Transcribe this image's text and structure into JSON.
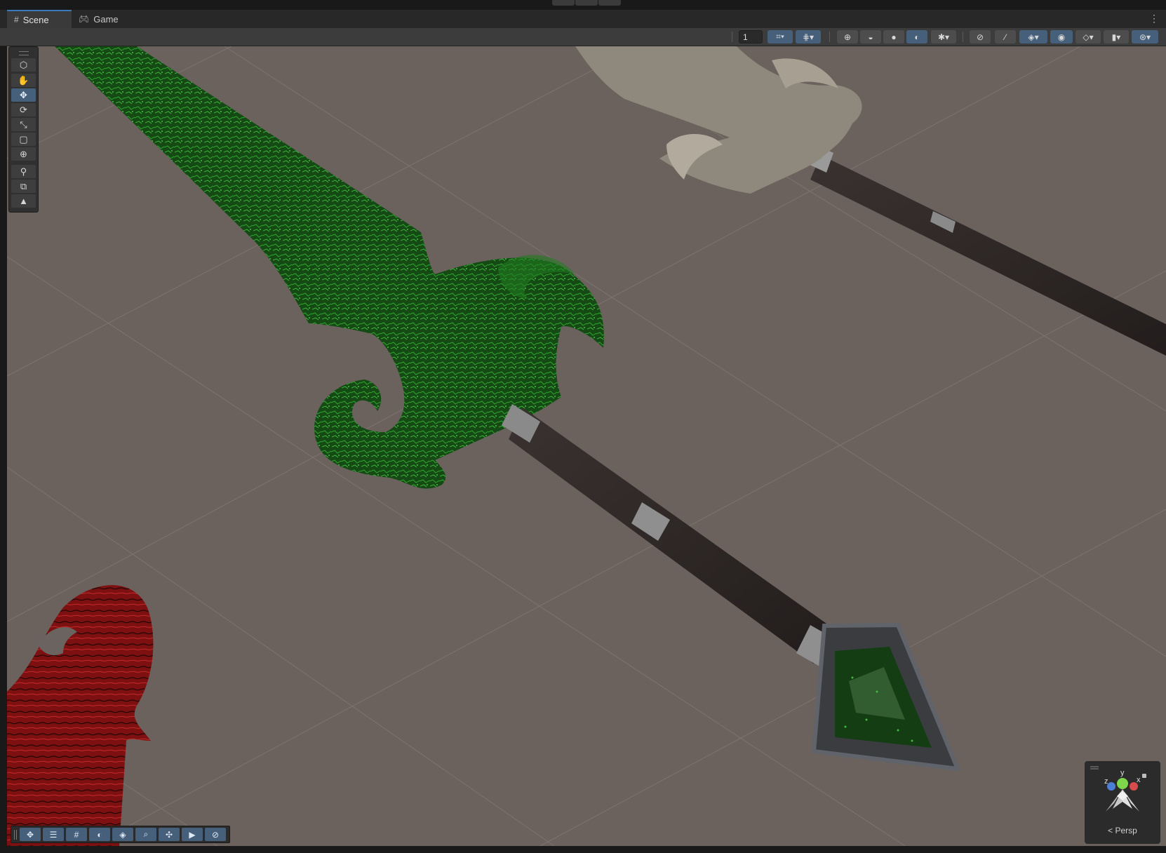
{
  "tabs": [
    {
      "label": "Scene",
      "icon": "grid-icon",
      "active": true
    },
    {
      "label": "Game",
      "icon": "gamepad-icon",
      "active": false
    }
  ],
  "toolbar": {
    "grid_snap_value": "1",
    "buttons": [
      "grid-visibility-icon",
      "snap-increment-icon",
      "draw-mode-icon",
      "global-icon",
      "shaded-sphere-icon",
      "lighting-icon",
      "gizmos-bug-icon",
      "audio-mute-icon",
      "effects-icon",
      "layers-icon",
      "scene-visibility-icon",
      "render-layers-icon",
      "camera-icon",
      "gizmo-toggle-icon"
    ]
  },
  "tool_palette": [
    {
      "name": "view-tool",
      "glyph": "✋",
      "active": false
    },
    {
      "name": "move-tool",
      "glyph": "✥",
      "active": true
    },
    {
      "name": "rotate-tool",
      "glyph": "⟳",
      "active": false
    },
    {
      "name": "scale-tool",
      "glyph": "⤡",
      "active": false
    },
    {
      "name": "rect-tool",
      "glyph": "▢",
      "active": false
    },
    {
      "name": "transform-tool",
      "glyph": "⊕",
      "active": false
    },
    {
      "name": "custom-tool",
      "glyph": "⚲",
      "active": false
    },
    {
      "name": "copy-tool",
      "glyph": "⧉",
      "active": false
    },
    {
      "name": "terrain-tool",
      "glyph": "▲",
      "active": false
    }
  ],
  "bottom_overlay": [
    {
      "name": "move-overlay-icon",
      "glyph": "✥"
    },
    {
      "name": "settings-overlay-icon",
      "glyph": "☰"
    },
    {
      "name": "grid-overlay-icon",
      "glyph": "#"
    },
    {
      "name": "shading-overlay-icon",
      "glyph": "◐"
    },
    {
      "name": "layers-overlay-icon",
      "glyph": "◈"
    },
    {
      "name": "search-overlay-icon",
      "glyph": "⌕"
    },
    {
      "name": "pivot-overlay-icon",
      "glyph": "✣"
    },
    {
      "name": "camera-overlay-icon",
      "glyph": "▶"
    },
    {
      "name": "compass-overlay-icon",
      "glyph": "⊘"
    }
  ],
  "gizmo": {
    "view_mode": "< Persp",
    "axes": [
      "y",
      "z",
      "x"
    ]
  },
  "colors": {
    "accent": "#46607c",
    "viewport_bg": "#6b625e",
    "green_blade": "#1c6b1c",
    "red_blade": "#8a1515",
    "stone_blade": "#8f887c",
    "handle": "#2e2826"
  }
}
